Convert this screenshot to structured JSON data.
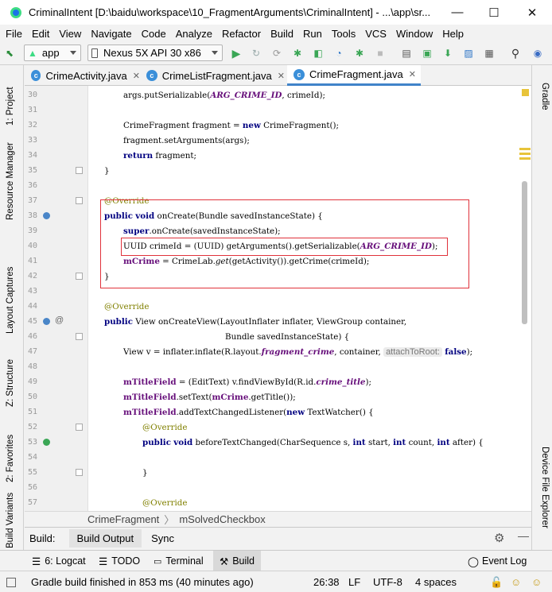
{
  "window": {
    "title": "CriminalIntent [D:\\baidu\\workspace\\10_FragmentArguments\\CriminalIntent] - ...\\app\\sr...",
    "minimize": "—",
    "maximize": "☐",
    "close": "✕"
  },
  "menu": [
    "File",
    "Edit",
    "View",
    "Navigate",
    "Code",
    "Analyze",
    "Refactor",
    "Build",
    "Run",
    "Tools",
    "VCS",
    "Window",
    "Help"
  ],
  "toolbar": {
    "module": "app",
    "device": "Nexus 5X API 30 x86"
  },
  "left_tool_tabs": [
    "1: Project",
    "Resource Manager",
    "Layout Captures",
    "Z: Structure",
    "2: Favorites",
    "Build Variants"
  ],
  "right_tool_tabs": [
    "Gradle",
    "Device File Explorer"
  ],
  "editor_tabs": [
    {
      "label": "CrimeActivity.java",
      "active": false
    },
    {
      "label": "CrimeListFragment.java",
      "active": false
    },
    {
      "label": "CrimeFragment.java",
      "active": true
    }
  ],
  "code_lines": [
    {
      "n": "30"
    },
    {
      "n": "31"
    },
    {
      "n": "32"
    },
    {
      "n": "33"
    },
    {
      "n": "34"
    },
    {
      "n": "35"
    },
    {
      "n": "36"
    },
    {
      "n": "37"
    },
    {
      "n": "38"
    },
    {
      "n": "39"
    },
    {
      "n": "40"
    },
    {
      "n": "41"
    },
    {
      "n": "42"
    },
    {
      "n": "43"
    },
    {
      "n": "44"
    },
    {
      "n": "45"
    },
    {
      "n": "46"
    },
    {
      "n": "47"
    },
    {
      "n": "48"
    },
    {
      "n": "49"
    },
    {
      "n": "50"
    },
    {
      "n": "51"
    },
    {
      "n": "52"
    },
    {
      "n": "53"
    },
    {
      "n": "54"
    },
    {
      "n": "55"
    },
    {
      "n": "56"
    },
    {
      "n": "57"
    }
  ],
  "code": {
    "l30_a": "args.putSerializable(",
    "l30_b": "ARG_CRIME_ID",
    "l30_c": ", crimeId);",
    "l32_a": "CrimeFragment fragment = ",
    "l32_kw": "new",
    "l32_b": " CrimeFragment();",
    "l33": "fragment.setArguments(args);",
    "l34_kw": "return",
    "l34_b": " fragment;",
    "l35": "}",
    "l37": "@Override",
    "l38_kw1": "public",
    "l38_kw2": "void",
    "l38_b": " onCreate(Bundle savedInstanceState) {",
    "l39_kw": "super",
    "l39_b": ".onCreate(savedInstanceState);",
    "l40_a": "UUID crimeId = (UUID) getArguments().getSerializable(",
    "l40_b": "ARG_CRIME_ID",
    "l40_c": ");",
    "l41_f": "mCrime",
    "l41_a": " = CrimeLab.",
    "l41_i": "get",
    "l41_b": "(getActivity()).getCrime(crimeId);",
    "l42": "}",
    "l44": "@Override",
    "l45_kw": "public",
    "l45_b": " View onCreateView(LayoutInflater inflater, ViewGroup container,",
    "l46": "Bundle savedInstanceState) {",
    "l47_a": "View v = inflater.inflate(R.layout.",
    "l47_f": "fragment_crime",
    "l47_b": ", container, ",
    "l47_hint": "attachToRoot:",
    "l47_kw": "false",
    "l47_c": ");",
    "l49_f": "mTitleField",
    "l49_a": " = (EditText) v.findViewById(R.id.",
    "l49_f2": "crime_title",
    "l49_b": ");",
    "l50_f": "mTitleField",
    "l50_a": ".setText(",
    "l50_f2": "mCrime",
    "l50_b": ".getTitle());",
    "l51_f": "mTitleField",
    "l51_a": ".addTextChangedListener(",
    "l51_kw": "new",
    "l51_b": " TextWatcher() {",
    "l52": "@Override",
    "l53_kw1": "public",
    "l53_kw2": "void",
    "l53_a": " beforeTextChanged(CharSequence s, ",
    "l53_kw3": "int",
    "l53_b": " start, ",
    "l53_kw4": "int",
    "l53_c": " count, ",
    "l53_kw5": "int",
    "l53_d": " after) {",
    "l55": "}",
    "l57": "@Override"
  },
  "breadcrumb": [
    "CrimeFragment",
    "mSolvedCheckbox"
  ],
  "build_bar": {
    "label": "Build:",
    "tabs": [
      "Build Output",
      "Sync"
    ]
  },
  "bottom_tabs": [
    "6: Logcat",
    "TODO",
    "Terminal",
    "Build",
    "Event Log"
  ],
  "status": {
    "message": "Gradle build finished in 853 ms (40 minutes ago)",
    "position": "26:38",
    "line_sep": "LF",
    "encoding": "UTF-8",
    "indent": "4 spaces"
  },
  "colors": {
    "keyword": "#000080",
    "annotation": "#808000",
    "field": "#660e7a",
    "highlight_box": "#e0323b",
    "active_tab_underline": "#4083c9"
  }
}
